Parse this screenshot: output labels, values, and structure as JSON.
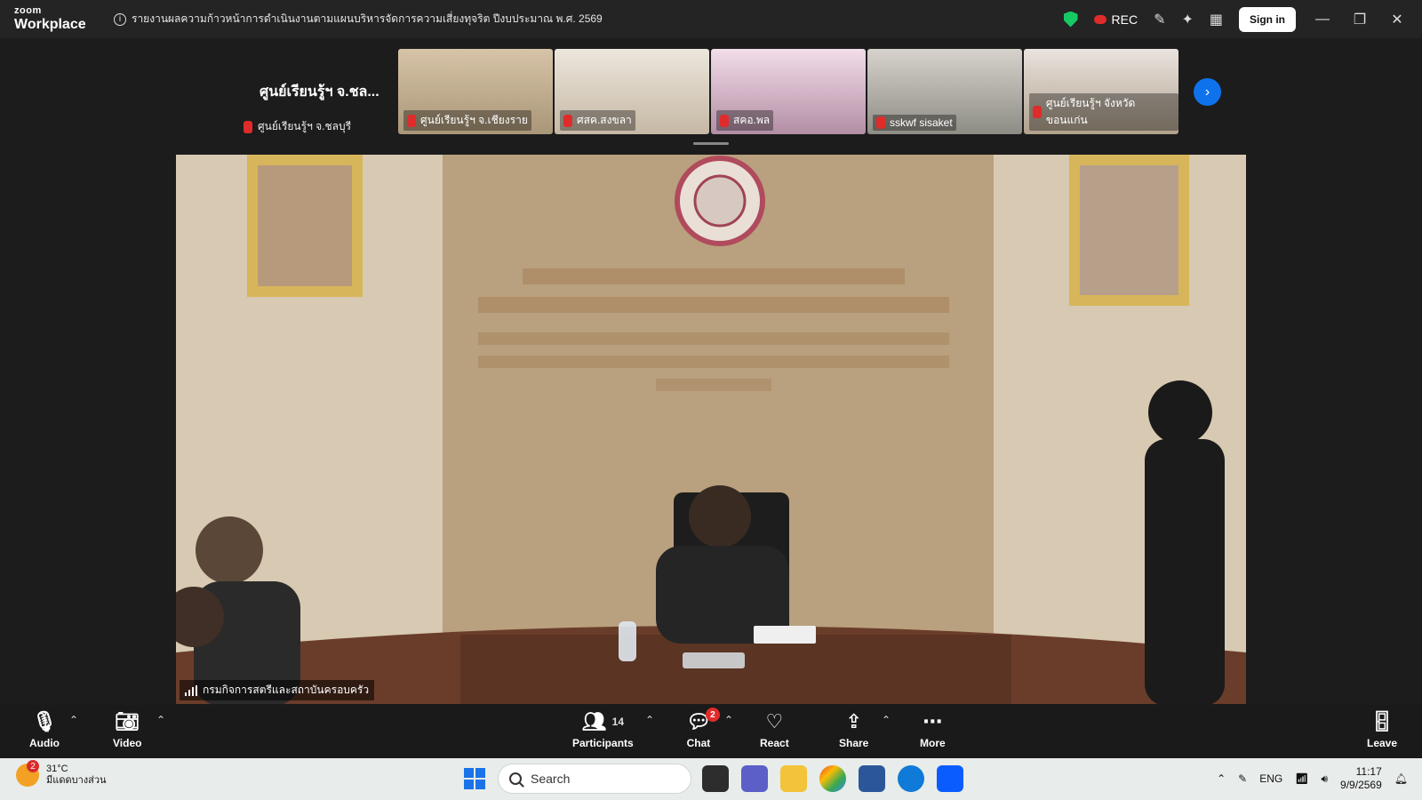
{
  "app": {
    "brand_top": "zoom",
    "brand_bottom": "Workplace",
    "meeting_title": "รายงานผลความก้าวหน้าการดำเนินงานตามแผนบริหารจัดการความเสี่ยงทุจริต ปีงบประมาณ พ.ศ. 2569",
    "rec_label": "REC",
    "signin_label": "Sign in",
    "window_controls": {
      "minimize": "—",
      "restore": "❐",
      "close": "✕"
    }
  },
  "strip": {
    "current_label": "ศูนย์เรียนรู้ฯ จ.ชล...",
    "current_name": "ศูนย์เรียนรู้ฯ จ.ชลบุรี",
    "thumbnails": [
      {
        "name": "ศูนย์เรียนรู้ฯ จ.เชียงราย"
      },
      {
        "name": "ศสค.สงขลา"
      },
      {
        "name": "สคอ.พล"
      },
      {
        "name": "sskwf sisaket"
      },
      {
        "name": "ศูนย์เรียนรู้ฯ จังหวัดขอนแก่น"
      }
    ]
  },
  "main_video": {
    "speaker_name": "กรมกิจการสตรีและสถาบันครอบครัว"
  },
  "toolbar": {
    "audio_label": "Audio",
    "video_label": "Video",
    "participants_label": "Participants",
    "participants_count": "14",
    "chat_label": "Chat",
    "chat_badge": "2",
    "react_label": "React",
    "share_label": "Share",
    "more_label": "More",
    "leave_label": "Leave"
  },
  "taskbar": {
    "weather_temp": "31°C",
    "weather_desc": "มีแดดบางส่วน",
    "weather_badge": "2",
    "search_placeholder": "Search",
    "language": "ENG",
    "time": "11:17",
    "date": "9/9/2569"
  },
  "colors": {
    "accent": "#0e72ed",
    "danger": "#e02b2b",
    "secure": "#17c964"
  }
}
